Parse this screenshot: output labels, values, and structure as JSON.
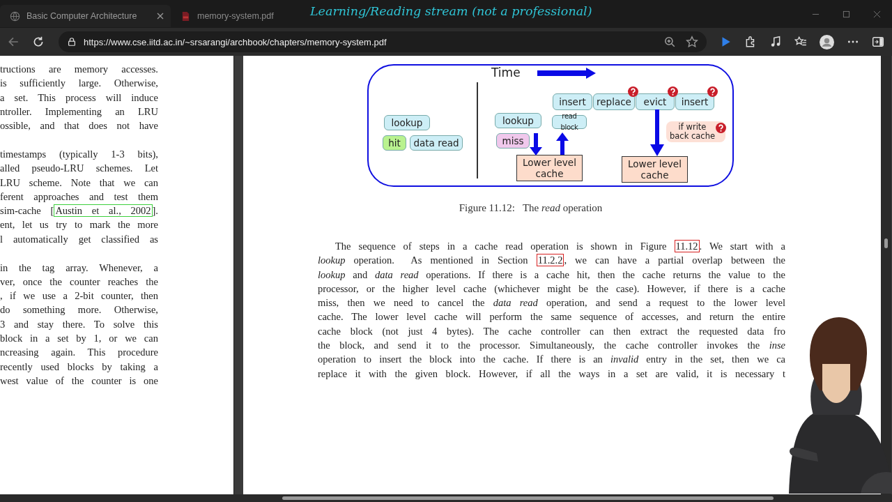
{
  "window": {
    "overlay_title": "Learning/Reading stream (not a professional)"
  },
  "tabs": [
    {
      "title": "Basic Computer Architecture",
      "selected": true,
      "kind": "web"
    },
    {
      "title": "memory-system.pdf",
      "selected": false,
      "kind": "pdf"
    }
  ],
  "address_bar": {
    "url": "https://www.cse.iitd.ac.in/~srsarangi/archbook/chapters/memory-system.pdf"
  },
  "left_page": {
    "paragraphs": [
      [
        [
          {
            "kind": "text",
            "text": "tructions are memory accesses."
          }
        ],
        [
          {
            "kind": "text",
            "text": "is sufficiently large. Otherwise,"
          }
        ],
        [
          {
            "kind": "text",
            "text": "a set. This process will induce"
          }
        ],
        [
          {
            "kind": "text",
            "text": "ntroller. Implementing an LRU"
          }
        ],
        [
          {
            "kind": "text",
            "text": "ossible, and that does not have"
          }
        ]
      ],
      [
        [
          {
            "kind": "text",
            "text": "timestamps (typically 1-3 bits),"
          }
        ],
        [
          {
            "kind": "text",
            "text": "alled pseudo-LRU schemes. Let"
          }
        ],
        [
          {
            "kind": "text",
            "text": "LRU scheme. Note that we can"
          }
        ],
        [
          {
            "kind": "text",
            "text": "ferent approaches and test them"
          }
        ],
        [
          {
            "kind": "text",
            "text": "sim-cache ["
          },
          {
            "kind": "link",
            "text": "Austin et al., 2002",
            "color": "#3ccf3c"
          },
          {
            "kind": "text",
            "text": "]."
          }
        ],
        [
          {
            "kind": "text",
            "text": "ent, let us try to mark the more"
          }
        ],
        [
          {
            "kind": "text",
            "text": "l automatically get classified as"
          }
        ]
      ],
      [
        [
          {
            "kind": "text",
            "text": "in the tag array. Whenever, a"
          }
        ],
        [
          {
            "kind": "text",
            "text": "ver, once the counter reaches the"
          }
        ],
        [
          {
            "kind": "text",
            "text": ", if we use a 2-bit counter, then"
          }
        ],
        [
          {
            "kind": "text",
            "text": "do something more. Otherwise,"
          }
        ],
        [
          {
            "kind": "text",
            "text": "3 and stay there. To solve this"
          }
        ],
        [
          {
            "kind": "text",
            "text": "block in a set by 1, or we can"
          }
        ],
        [
          {
            "kind": "text",
            "text": "ncreasing again. This procedure"
          }
        ],
        [
          {
            "kind": "text",
            "text": "recently used blocks by taking a"
          }
        ],
        [
          {
            "kind": "text",
            "text": "west value of the counter is one"
          }
        ]
      ]
    ]
  },
  "figure": {
    "time_label": "Time",
    "nodes": [
      {
        "text": "lookup",
        "kind": "step",
        "color": "#cdeef6",
        "question": false
      },
      {
        "text": "hit",
        "kind": "step",
        "color": "#b9f28f",
        "question": false
      },
      {
        "text": "data read",
        "kind": "step",
        "color": "#cdeef6",
        "question": false
      },
      {
        "text": "lookup",
        "kind": "step",
        "color": "#cdeef6",
        "question": false
      },
      {
        "text": "miss",
        "kind": "step",
        "color": "#f0c8ec",
        "question": false
      },
      {
        "text": "insert",
        "kind": "step",
        "color": "#cdeef6",
        "question": false
      },
      {
        "text": "replace",
        "kind": "step",
        "color": "#cdeef6",
        "question": true
      },
      {
        "text": "evict",
        "kind": "step",
        "color": "#cdeef6",
        "question": true
      },
      {
        "text": "insert",
        "kind": "step",
        "color": "#cdeef6",
        "question": true
      },
      {
        "text": "read block",
        "kind": "small",
        "color": "#cdeef6",
        "question": false
      },
      {
        "text": "if write back cache",
        "kind": "note",
        "color": "#fde0d6",
        "question": true
      },
      {
        "text": "Lower level cache",
        "kind": "cache",
        "color": "#fddccb",
        "question": false
      },
      {
        "text": "Lower level cache",
        "kind": "cache",
        "color": "#fddccb",
        "question": false
      }
    ],
    "caption": "Figure 11.12:   The *read* operation"
  },
  "right_page": {
    "lines": [
      [
        {
          "kind": "text",
          "text": "The sequence of steps in a cache read operation is shown in Figure "
        },
        {
          "kind": "link",
          "text": "11.12",
          "color": "#d62020"
        },
        {
          "kind": "text",
          "text": ". We start with a"
        }
      ],
      [
        {
          "kind": "text",
          "text": "*lookup* operation.  As mentioned in Section "
        },
        {
          "kind": "link",
          "text": "11.2.2",
          "color": "#d62020"
        },
        {
          "kind": "text",
          "text": ", we can have a partial overlap between the"
        }
      ],
      [
        {
          "kind": "text",
          "text": "*lookup* and *data read* operations. If there is a cache hit, then the cache returns the value to the"
        }
      ],
      [
        {
          "kind": "text",
          "text": "processor, or the higher level cache (whichever might be the case). However, if there is a cache"
        }
      ],
      [
        {
          "kind": "text",
          "text": "miss, then we need to cancel the *data read* operation, and send a request to the lower level"
        }
      ],
      [
        {
          "kind": "text",
          "text": "cache. The lower level cache will perform the same sequence of accesses, and return the entire"
        }
      ],
      [
        {
          "kind": "text",
          "text": "cache block (not just 4 bytes). The cache controller can then extract the requested data fro"
        }
      ],
      [
        {
          "kind": "text",
          "text": "the block, and send it to the processor. Simultaneously, the cache controller invokes the *inse*"
        }
      ],
      [
        {
          "kind": "text",
          "text": "operation to insert the block into the cache. If there is an *invalid* entry in the set, then we ca"
        }
      ],
      [
        {
          "kind": "text",
          "text": "replace it with the given block. However, if all the ways in a set are valid, it is necessary t"
        }
      ]
    ]
  }
}
